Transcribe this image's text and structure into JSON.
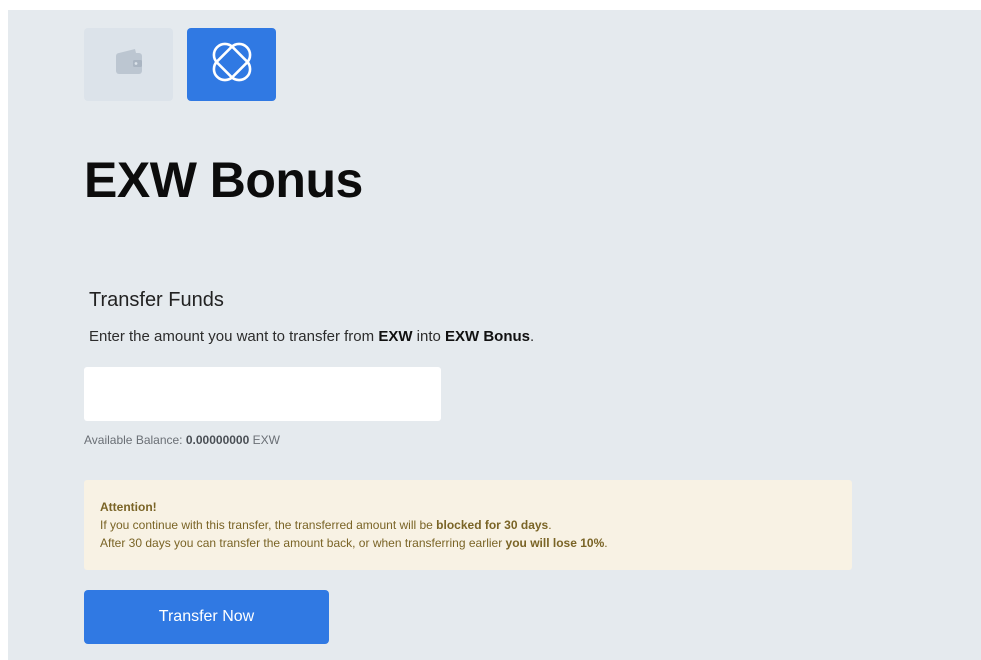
{
  "tabs": [
    {
      "icon": "wallet-icon",
      "active": false
    },
    {
      "icon": "bonus-icon",
      "active": true
    }
  ],
  "page": {
    "title": "EXW Bonus"
  },
  "transfer": {
    "section_title": "Transfer Funds",
    "desc_pre": "Enter the amount you want to transfer from ",
    "desc_from": "EXW",
    "desc_mid": " into ",
    "desc_to": "EXW Bonus",
    "desc_post": ".",
    "amount_value": "",
    "balance_label": "Available Balance: ",
    "balance_value": "0.00000000",
    "balance_currency": " EXW"
  },
  "attention": {
    "title": "Attention!",
    "line1_pre": "If you continue with this transfer, the transferred amount will be ",
    "line1_bold": "blocked for 30 days",
    "line1_post": ".",
    "line2_pre": "After 30 days you can transfer the amount back, or when transferring earlier ",
    "line2_bold": "you will lose 10%",
    "line2_post": "."
  },
  "actions": {
    "transfer_label": "Transfer Now"
  },
  "colors": {
    "accent": "#3079e3",
    "background": "#e5eaee",
    "attention_bg": "#f8f2e4",
    "attention_text": "#7a6426"
  }
}
